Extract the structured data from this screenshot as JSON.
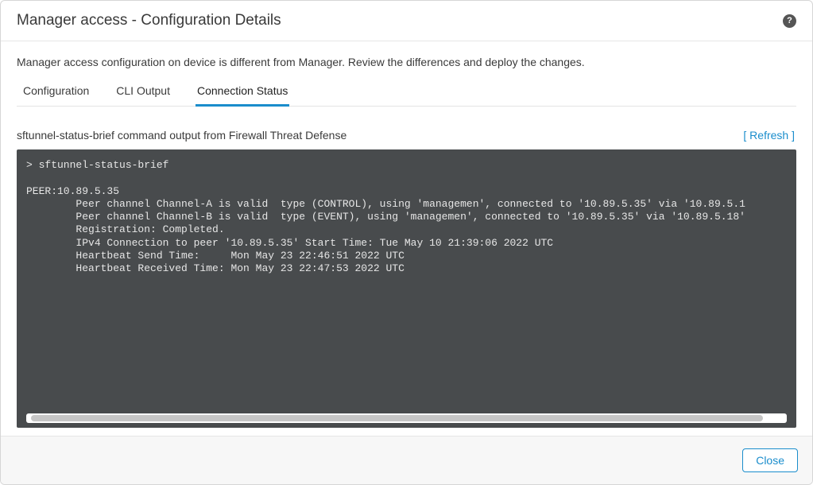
{
  "header": {
    "title": "Manager access - Configuration Details"
  },
  "description": "Manager access configuration on device is different from Manager. Review the differences and deploy the changes.",
  "tabs": [
    {
      "label": "Configuration",
      "active": false
    },
    {
      "label": "CLI Output",
      "active": false
    },
    {
      "label": "Connection Status",
      "active": true
    }
  ],
  "panel": {
    "title": "sftunnel-status-brief command output from Firewall Threat Defense",
    "refresh_label": "[ Refresh ]"
  },
  "terminal_output": "> sftunnel-status-brief\n\nPEER:10.89.5.35\n        Peer channel Channel-A is valid  type (CONTROL), using 'managemen', connected to '10.89.5.35' via '10.89.5.1\n        Peer channel Channel-B is valid  type (EVENT), using 'managemen', connected to '10.89.5.35' via '10.89.5.18'\n        Registration: Completed.\n        IPv4 Connection to peer '10.89.5.35' Start Time: Tue May 10 21:39:06 2022 UTC\n        Heartbeat Send Time:     Mon May 23 22:46:51 2022 UTC\n        Heartbeat Received Time: Mon May 23 22:47:53 2022 UTC",
  "footer": {
    "close_label": "Close"
  }
}
